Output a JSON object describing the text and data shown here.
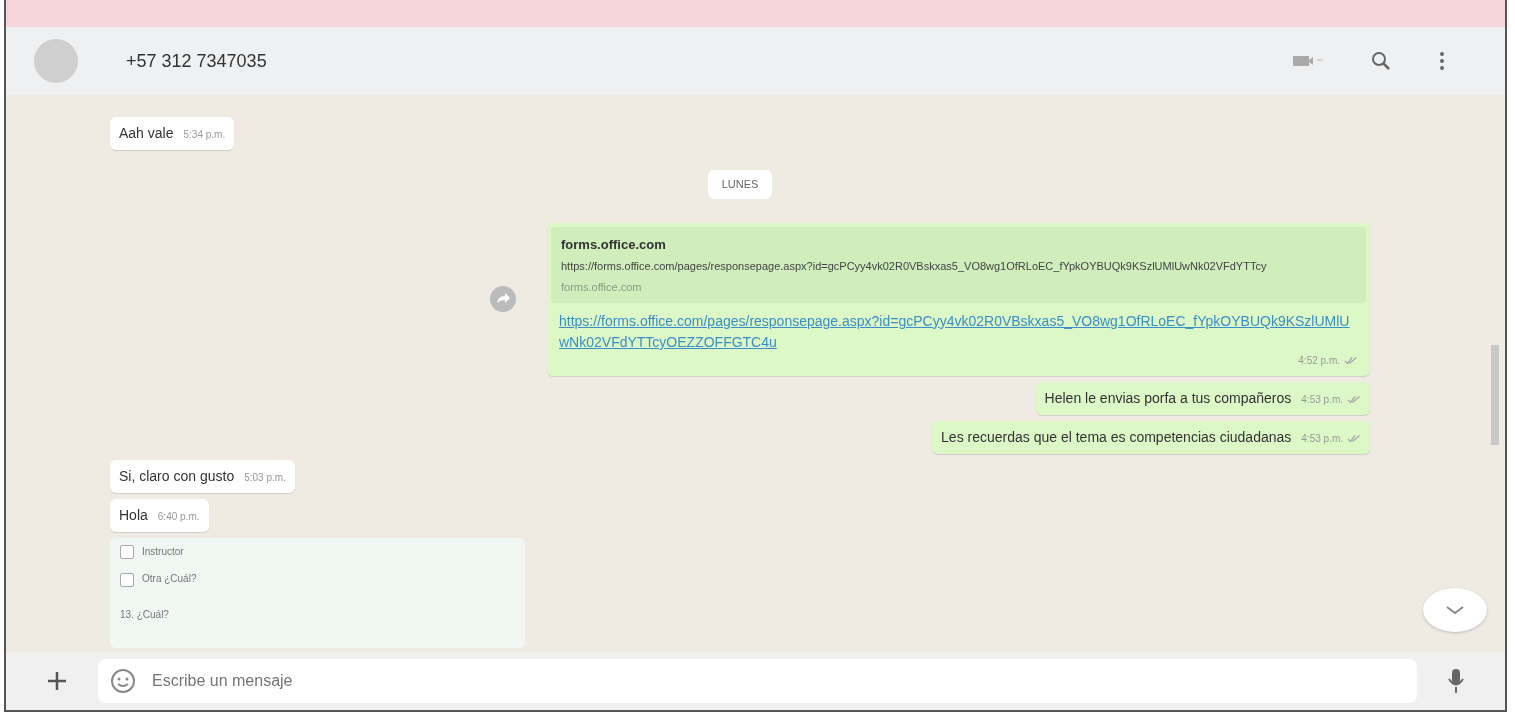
{
  "contact": {
    "name": "+57 312 7347035"
  },
  "messages": [
    {
      "kind": "text",
      "outgoing": false,
      "text": "Aah vale",
      "time": "5:34 p.m."
    },
    {
      "kind": "date",
      "text": "LUNES"
    },
    {
      "kind": "link",
      "outgoing": true,
      "forward_icon": true,
      "preview": {
        "title": "forms.office.com",
        "description": "https://forms.office.com/pages/responsepage.aspx?id=gcPCyy4vk02R0VBskxas5_VO8wg1OfRLoEC_fYpkOYBUQk9KSzlUMlUwNk02VFdYTTcy",
        "domain": "forms.office.com"
      },
      "url": "https://forms.office.com/pages/responsepage.aspx?id=gcPCyy4vk02R0VBskxas5_VO8wg1OfRLoEC_fYpkOYBUQk9KSzlUMlUwNk02VFdYTTcyOEZZOFFGTC4u",
      "time": "4:52 p.m.",
      "read": false
    },
    {
      "kind": "text",
      "outgoing": true,
      "text": "Helen le envias porfa a tus compañeros",
      "time": "4:53 p.m.",
      "read": false
    },
    {
      "kind": "text",
      "outgoing": true,
      "text": "Les recuerdas que el tema es competencias ciudadanas",
      "time": "4:53 p.m.",
      "read": false
    },
    {
      "kind": "text",
      "outgoing": false,
      "text": "Si, claro con gusto",
      "time": "5:03 p.m."
    },
    {
      "kind": "text",
      "outgoing": false,
      "text": "Hola",
      "time": "6:40 p.m."
    },
    {
      "kind": "form_image",
      "outgoing": false,
      "options": [
        {
          "label": "Instructor",
          "checked": false
        },
        {
          "label": "Otra ¿Cuál?",
          "checked": false
        }
      ],
      "question": "13. ¿Cuál?"
    }
  ],
  "composer": {
    "placeholder": "Escribe un mensaje"
  }
}
